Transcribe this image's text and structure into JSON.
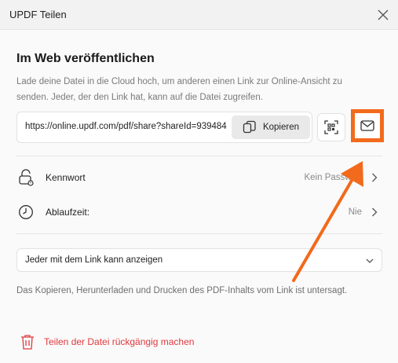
{
  "window": {
    "title": "UPDF Teilen"
  },
  "section": {
    "heading": "Im Web veröffentlichen",
    "description": "Lade deine Datei in die Cloud hoch, um anderen einen Link zur Online-Ansicht zu senden. Jeder, der den Link hat, kann auf die Datei zugreifen."
  },
  "link": {
    "url": "https://online.updf.com/pdf/share?shareId=939484",
    "copy_label": "Kopieren"
  },
  "settings": [
    {
      "label": "Kennwort",
      "value": "Kein Passwort"
    },
    {
      "label": "Ablaufzeit:",
      "value": "Nie"
    }
  ],
  "permission": {
    "selected": "Jeder mit dem Link kann anzeigen"
  },
  "note": "Das Kopieren, Herunterladen und Drucken des PDF-Inhalts vom Link ist untersagt.",
  "unshare": {
    "label": "Teilen der Datei rückgängig machen"
  },
  "colors": {
    "highlight": "#f26a1b",
    "danger": "#e0393e"
  },
  "icons": [
    "close-icon",
    "copy-icon",
    "qr-scan-icon",
    "mail-icon",
    "lock-icon",
    "clock-icon",
    "chevron-right-icon",
    "chevron-down-icon",
    "trash-icon",
    "annotation-arrow"
  ]
}
